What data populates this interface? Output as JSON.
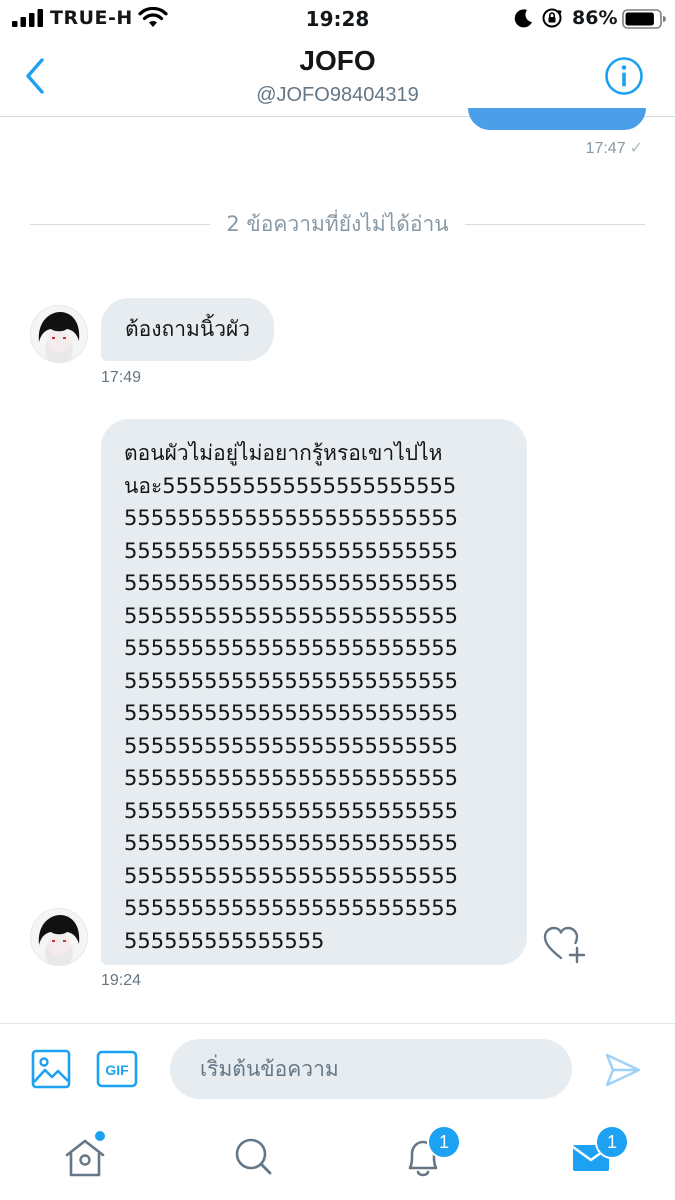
{
  "status_bar": {
    "carrier": "TRUE-H",
    "time": "19:28",
    "battery_percent": "86%",
    "battery_level": 0.86,
    "icons": [
      "signal-icon",
      "wifi-icon",
      "moon-icon",
      "rotation-lock-icon",
      "battery-icon"
    ]
  },
  "header": {
    "title": "JOFO",
    "handle": "@JOFO98404319",
    "back_icon": "chevron-left-icon",
    "info_icon": "info-icon"
  },
  "conversation": {
    "previous_sent_time": "17:47",
    "unread_divider": "2 ข้อความที่ยังไม่ได้อ่าน",
    "messages": [
      {
        "text": "ต้องถามนิ้วผัว",
        "time": "17:49"
      },
      {
        "lines": [
          "ตอนผัวไม่อยู่ไม่อยากรู้หรอเขาไปไห",
          "นอะ5555555555555555555555",
          "5555555555555555555555555",
          "5555555555555555555555555",
          "5555555555555555555555555",
          "5555555555555555555555555",
          "5555555555555555555555555",
          "5555555555555555555555555",
          "5555555555555555555555555",
          "5555555555555555555555555",
          "5555555555555555555555555",
          "5555555555555555555555555",
          "5555555555555555555555555",
          "5555555555555555555555555",
          "5555555555555555555555555",
          "555555555555555"
        ],
        "time": "19:24"
      }
    ]
  },
  "composer": {
    "placeholder": "เริ่มต้นข้อความ",
    "gif_label": "GIF",
    "image_icon": "image-icon",
    "send_icon": "send-icon"
  },
  "tab_bar": {
    "home_icon": "home-icon",
    "search_icon": "search-icon",
    "notifications_icon": "bell-icon",
    "notifications_badge": "1",
    "messages_icon": "mail-icon",
    "messages_badge": "1"
  },
  "colors": {
    "accent": "#1da1f2",
    "sent_bubble": "#4a9fe8",
    "received_bubble": "#e6ecf0",
    "secondary_text": "#657786"
  }
}
